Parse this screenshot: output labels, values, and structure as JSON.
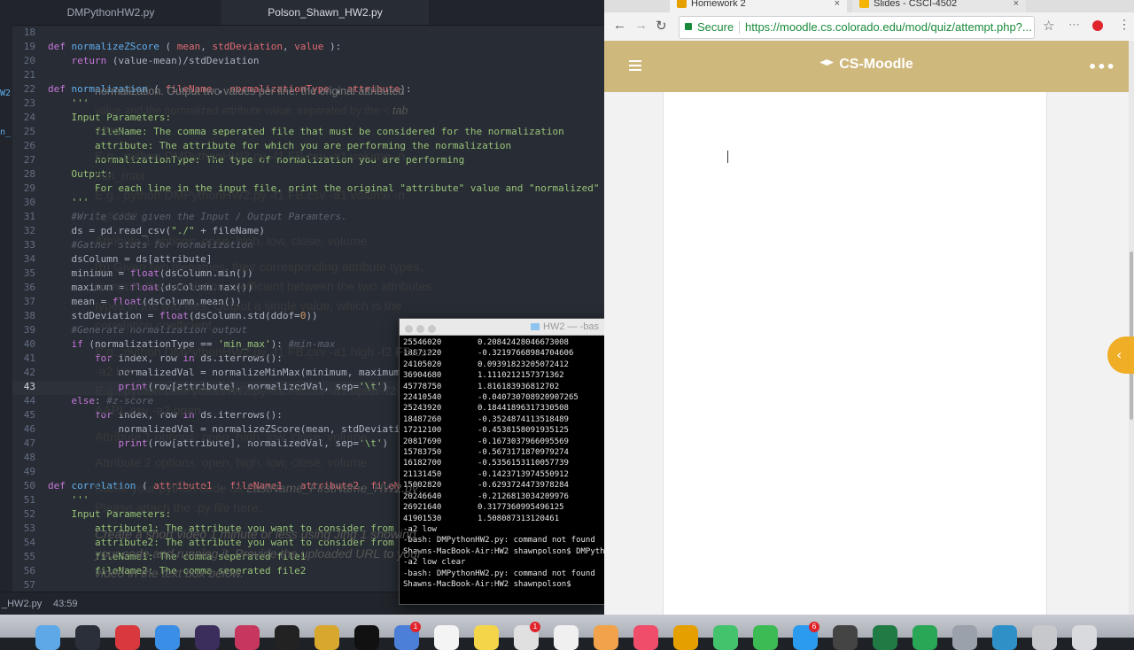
{
  "editor": {
    "tabs": [
      "DMPythonHW2.py",
      "Polson_Shawn_HW2.py"
    ],
    "gutter_fragments": [
      "W2",
      "n_"
    ],
    "status": {
      "file": "_HW2.py",
      "cursor": "43:59"
    },
    "lines": [
      {
        "n": "18",
        "html": ""
      },
      {
        "n": "19",
        "html": "<span class=\"kw\">def</span> <span class=\"fn\">normalizeZScore</span> ( <span class=\"pm\">mean</span>, <span class=\"pm\">stdDeviation</span>, <span class=\"pm\">value</span> ):"
      },
      {
        "n": "20",
        "html": "    <span class=\"kw\">return</span> (value-mean)/stdDeviation"
      },
      {
        "n": "21",
        "html": ""
      },
      {
        "n": "22",
        "html": "<span class=\"kw\">def</span> <span class=\"fn\">normalization</span> ( <span class=\"pm\">fileName</span> , <span class=\"pm\">normalizationType</span> , <span class=\"pm\">attribute</span>):"
      },
      {
        "n": "23",
        "html": "    <span class=\"str\">'''</span>"
      },
      {
        "n": "24",
        "html": "<span class=\"str\">    Input Parameters:</span>"
      },
      {
        "n": "25",
        "html": "<span class=\"str\">        fileName: The comma seperated file that must be considered for the normalization</span>"
      },
      {
        "n": "26",
        "html": "<span class=\"str\">        attribute: The attribute for which you are performing the normalization</span>"
      },
      {
        "n": "27",
        "html": "<span class=\"str\">        normalizationType: The type of normalization you are performing</span>"
      },
      {
        "n": "28",
        "html": "<span class=\"str\">    Output:</span>"
      },
      {
        "n": "29",
        "html": "<span class=\"str\">        For each line in the input file, print the original \"attribute\" value and \"normalized\" val</span>"
      },
      {
        "n": "30",
        "html": "<span class=\"str\">    '''</span>"
      },
      {
        "n": "31",
        "html": "    <span class=\"cm\">#Write code given the Input / Output Paramters.</span>"
      },
      {
        "n": "32",
        "html": "    ds = pd.read_csv(<span class=\"str\">\"./\"</span> + fileName)"
      },
      {
        "n": "33",
        "html": "    <span class=\"cm\">#Gather stats for normalization</span>"
      },
      {
        "n": "34",
        "html": "    dsColumn = ds[attribute]"
      },
      {
        "n": "35",
        "html": "    minimum = <span class=\"kw\">float</span>(dsColumn.min())"
      },
      {
        "n": "36",
        "html": "    maximum = <span class=\"kw\">float</span>(dsColumn.max())"
      },
      {
        "n": "37",
        "html": "    mean = <span class=\"kw\">float</span>(dsColumn.mean())"
      },
      {
        "n": "38",
        "html": "    stdDeviation = <span class=\"kw\">float</span>(dsColumn.std(ddof=<span class=\"num\">0</span>))"
      },
      {
        "n": "39",
        "html": "    <span class=\"cm\">#Generate normalization output</span>"
      },
      {
        "n": "40",
        "html": "    <span class=\"kw\">if</span> (normalizationType == <span class=\"str\">'min_max'</span>): <span class=\"cm\">#min-max</span>"
      },
      {
        "n": "41",
        "html": "        <span class=\"kw\">for</span> index, row <span class=\"kw\">in</span> ds.iterrows():"
      },
      {
        "n": "42",
        "html": "            normalizedVal = normalizeMinMax(minimum, maximum,"
      },
      {
        "n": "43",
        "html": "            <span class=\"kw\">print</span>(row[attribute], normalizedVal, sep=<span class=\"str\">'\\t'</span>)"
      },
      {
        "n": "44",
        "html": "    <span class=\"kw\">else</span>: <span class=\"cm\">#z-score</span>"
      },
      {
        "n": "45",
        "html": "        <span class=\"kw\">for</span> index, row <span class=\"kw\">in</span> ds.iterrows():"
      },
      {
        "n": "46",
        "html": "            normalizedVal = normalizeZScore(mean, stdDeviation"
      },
      {
        "n": "47",
        "html": "            <span class=\"kw\">print</span>(row[attribute], normalizedVal, sep=<span class=\"str\">'\\t'</span>)"
      },
      {
        "n": "48",
        "html": ""
      },
      {
        "n": "49",
        "html": ""
      },
      {
        "n": "50",
        "html": "<span class=\"kw\">def</span> <span class=\"fn\">correlation</span> ( <span class=\"pm\">attribute1</span> , <span class=\"pm\">fileName1</span> , <span class=\"pm\">attribute2</span>, <span class=\"pm\">fileNam</span>"
      },
      {
        "n": "51",
        "html": "    <span class=\"str\">'''</span>"
      },
      {
        "n": "52",
        "html": "<span class=\"str\">    Input Parameters:</span>"
      },
      {
        "n": "53",
        "html": "<span class=\"str\">        attribute1: The attribute you want to consider from fi</span>"
      },
      {
        "n": "54",
        "html": "<span class=\"str\">        attribute2: The attribute you want to consider from fi</span>"
      },
      {
        "n": "55",
        "html": "<span class=\"str\">        fileName1: The comma seperated file1</span>"
      },
      {
        "n": "56",
        "html": "<span class=\"str\">        fileName2: The comma seperated file2</span>"
      },
      {
        "n": "57",
        "html": ""
      }
    ]
  },
  "terminal": {
    "title": "HW2 — -bas",
    "rows": [
      [
        "25546020",
        "0.20842428046673008"
      ],
      [
        "18871220",
        "-0.32197668984704606"
      ],
      [
        "24105020",
        "0.09391823205072412"
      ],
      [
        "36904680",
        "1.1110212157371362"
      ],
      [
        "45778750",
        "1.816183936812702"
      ],
      [
        "22410540",
        "-0.040730708920907265"
      ],
      [
        "25243920",
        "0.18441896317330508"
      ],
      [
        "18487260",
        "-0.3524874113518489"
      ],
      [
        "17212100",
        "-0.4538158091935125"
      ],
      [
        "20817690",
        "-0.1673037966095569"
      ],
      [
        "15783750",
        "-0.5673171870979274"
      ],
      [
        "16182700",
        "-0.5356153110057739"
      ],
      [
        "21131450",
        "-0.1423713974550912"
      ],
      [
        "15002820",
        "-0.6293724473978284"
      ],
      [
        "20246640",
        "-0.2126813034209976"
      ],
      [
        "26921640",
        "0.3177360995496125"
      ],
      [
        "41901530",
        "1.508087313120461"
      ]
    ],
    "lines": [
      "-a2 low",
      "-bash: DMPythonHW2.py: command not found",
      "Shawns-MacBook-Air:HW2 shawnpolson$ DMPytho",
      "-a2 low clear",
      "-bash: DMPythonHW2.py: command not found",
      "Shawns-MacBook-Air:HW2 shawnpolson$"
    ]
  },
  "browser": {
    "tabs": [
      {
        "label": "Homework 2",
        "close": "×"
      },
      {
        "label": "Slides - CSCI-4502",
        "close": "×"
      }
    ],
    "toolbar": {
      "back": "←",
      "forward": "→",
      "reload": "↻",
      "secure": "Secure",
      "url": "https://moodle.cs.colorado.edu/mod/quiz/attempt.php?...",
      "star": "☆",
      "ext": "⋯",
      "menu": "⋮"
    },
    "header": {
      "brand": "CS-Moodle",
      "more": "•••"
    },
    "drawer": "‹",
    "content": {
      "cutoff": "normalization. Output two values per line: the original attributed",
      "p1a": "value and the normalized attribute value, separated by the < ",
      "p1b": "tab",
      "p1c": "> key.",
      "eg1": "E.g., python DMPythonHW2.py -f1 FB.csv -a1 volume -n min_max",
      "eg2": "E.g., python DMPythonHW2.py -f1 FB.csv -a1 volume -n z_score",
      "attr1": "Attribute 1 options: open, high, low, close, volume",
      "b": "(b) Given two filenames, their corresponding attribute types, compute the correlation coefficient between the two attributes types in the two files. Output a single value, which is the correlation coefficient.",
      "eg3": "E.g., python DMPythonHW2.py -f1 FB.csv -a1 high -f2 FB.csv -a2 low",
      "eg4": "E.g., python DMPythonHW2.py -f1 FB.csv -a1 open -f2 AAPL.csv -a2 open",
      "attr1b": "Attribute 1 options: open, high, low, close, volume",
      "attr2": "Attribute 2 options: open, high, low, close, volume",
      "name1": "Name your python code as ",
      "name_em": "LastName_FirstName_HW2.py",
      "name2": ". Please attach the .py file here.",
      "video": "Create a short video 1 minute or less using Jing 1 showing your code and running it. Provide the uploaded URL to your video in the text box below."
    }
  },
  "dock": {
    "icons": [
      {
        "name": "finder-icon",
        "color": "#5fa8e8"
      },
      {
        "name": "launchpad-icon",
        "color": "#2a2f3a"
      },
      {
        "name": "app-red-icon",
        "color": "#d9393e"
      },
      {
        "name": "safari-icon",
        "color": "#3a8ee6"
      },
      {
        "name": "app-dark-icon",
        "color": "#3b2d5c"
      },
      {
        "name": "app-pink-icon",
        "color": "#c7365f"
      },
      {
        "name": "app-dark2-icon",
        "color": "#222"
      },
      {
        "name": "app-gold-icon",
        "color": "#d8a72e"
      },
      {
        "name": "terminal-icon",
        "color": "#111"
      },
      {
        "name": "app-blue-icon",
        "color": "#4b7fd8",
        "badge": "1"
      },
      {
        "name": "calendar-icon",
        "color": "#f4f4f4"
      },
      {
        "name": "notes-icon",
        "color": "#f4d54a"
      },
      {
        "name": "mail-icon",
        "color": "#e0e0e0",
        "badge": "1"
      },
      {
        "name": "app-white-icon",
        "color": "#f0f0f0"
      },
      {
        "name": "photos-icon",
        "color": "#f2a24a"
      },
      {
        "name": "music-icon",
        "color": "#ef4d6a"
      },
      {
        "name": "chrome-icon",
        "color": "#e5a000"
      },
      {
        "name": "messages-icon",
        "color": "#43c46c"
      },
      {
        "name": "facetime-icon",
        "color": "#3cba54"
      },
      {
        "name": "appstore-icon",
        "color": "#2b9bf0",
        "badge": "6"
      },
      {
        "name": "app-gray-icon",
        "color": "#444"
      },
      {
        "name": "excel-icon",
        "color": "#1f7a44"
      },
      {
        "name": "app-green-icon",
        "color": "#2aa657"
      },
      {
        "name": "prefs-icon",
        "color": "#9aa1aa"
      },
      {
        "name": "app-teal-icon",
        "color": "#2f90c8"
      },
      {
        "name": "downloads-icon",
        "color": "#c6c8cc"
      },
      {
        "name": "trash-icon",
        "color": "#d8dadd"
      }
    ]
  }
}
